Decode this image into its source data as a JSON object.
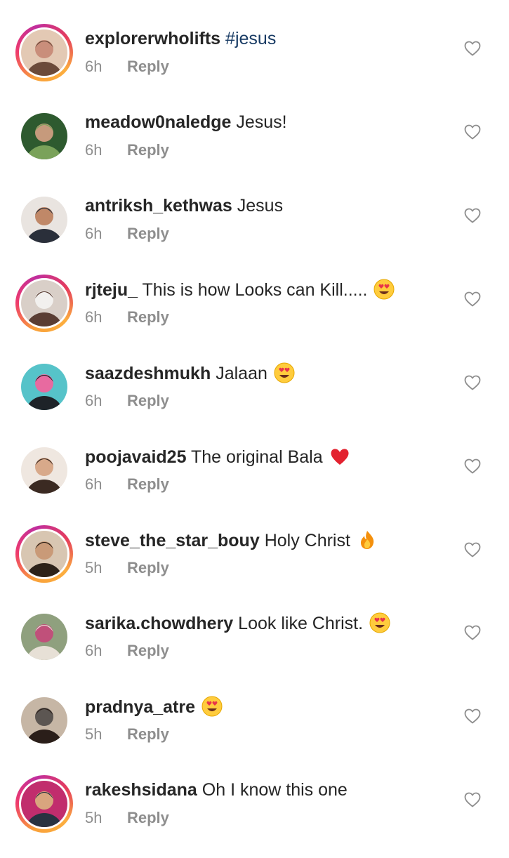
{
  "comments": [
    {
      "username": "explorerwholifts",
      "text": "",
      "hashtag": "#jesus",
      "emoji": "",
      "time": "6h",
      "reply": "Reply",
      "story": true,
      "avatar": "avatar-1"
    },
    {
      "username": "meadow0naledge",
      "text": "Jesus!",
      "hashtag": "",
      "emoji": "",
      "time": "6h",
      "reply": "Reply",
      "story": false,
      "avatar": "avatar-2"
    },
    {
      "username": "antriksh_kethwas",
      "text": "Jesus",
      "hashtag": "",
      "emoji": "",
      "time": "6h",
      "reply": "Reply",
      "story": false,
      "avatar": "avatar-3"
    },
    {
      "username": "rjteju_",
      "text": "This is how Looks can Kill.....",
      "hashtag": "",
      "emoji": "heart-eyes",
      "time": "6h",
      "reply": "Reply",
      "story": true,
      "avatar": "avatar-4"
    },
    {
      "username": "saazdeshmukh",
      "text": "Jalaan",
      "hashtag": "",
      "emoji": "heart-eyes",
      "time": "6h",
      "reply": "Reply",
      "story": false,
      "avatar": "avatar-5"
    },
    {
      "username": "poojavaid25",
      "text": "The original Bala",
      "hashtag": "",
      "emoji": "red-heart",
      "time": "6h",
      "reply": "Reply",
      "story": false,
      "avatar": "avatar-6"
    },
    {
      "username": "steve_the_star_bouy",
      "text": "Holy Christ",
      "hashtag": "",
      "emoji": "fire",
      "time": "5h",
      "reply": "Reply",
      "story": true,
      "avatar": "avatar-7"
    },
    {
      "username": "sarika.chowdhery",
      "text": "Look like Christ.",
      "hashtag": "",
      "emoji": "heart-eyes",
      "time": "6h",
      "reply": "Reply",
      "story": false,
      "avatar": "avatar-8"
    },
    {
      "username": "pradnya_atre",
      "text": "",
      "hashtag": "",
      "emoji": "heart-eyes",
      "time": "5h",
      "reply": "Reply",
      "story": false,
      "avatar": "avatar-9"
    },
    {
      "username": "rakeshsidana",
      "text": "Oh I know this one",
      "hashtag": "",
      "emoji": "",
      "time": "5h",
      "reply": "Reply",
      "story": true,
      "avatar": "avatar-10"
    }
  ],
  "colors": {
    "username": "#262626",
    "meta": "#8e8e8e",
    "hashtag": "#173a63",
    "heart_outline": "#8e8e8e"
  },
  "icons": {
    "like": "heart-outline-icon"
  }
}
